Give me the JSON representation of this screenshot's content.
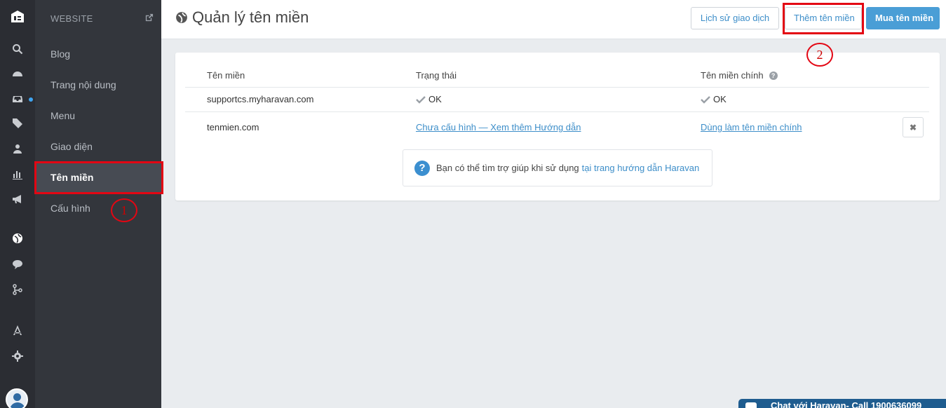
{
  "rail": {
    "icons": [
      "logo-icon",
      "search-icon",
      "dashboard-icon",
      "inbox-icon",
      "tag-icon",
      "users-icon",
      "bar-chart-icon",
      "megaphone-icon",
      "globe-icon",
      "chat-icon",
      "network-icon",
      "app-store-icon",
      "gear-icon",
      "avatar-icon"
    ]
  },
  "sidebar": {
    "header": "WEBSITE",
    "items": [
      {
        "label": "Blog"
      },
      {
        "label": "Trang nội dung"
      },
      {
        "label": "Menu"
      },
      {
        "label": "Giao diện"
      },
      {
        "label": "Tên miền"
      },
      {
        "label": "Cấu hình"
      }
    ],
    "active_index": 4
  },
  "header": {
    "title": "Quản lý tên miền",
    "buttons": {
      "history": "Lịch sử giao dịch",
      "add": "Thêm tên miền",
      "buy": "Mua tên miền"
    }
  },
  "table": {
    "headers": [
      "Tên miền",
      "Trạng thái",
      "Tên miền chính"
    ],
    "rows": [
      {
        "domain": "supportcs.myharavan.com",
        "status": "OK",
        "primary": "OK"
      },
      {
        "domain": "tenmien.com",
        "status": "Chưa cấu hình — Xem thêm Hướng dẫn",
        "primary": "Dùng làm tên miền chính"
      }
    ]
  },
  "help": {
    "text": "Bạn có thể tìm trợ giúp khi sử dụng",
    "link": "tại trang hướng dẫn Haravan"
  },
  "annotations": {
    "one": "1",
    "two": "2"
  },
  "chat": {
    "label": "Chat với Haravan- Call 1900636099"
  },
  "colors": {
    "accent": "#4a9ed6",
    "highlight": "#e30613",
    "sidebar": "#33363c",
    "rail": "#2b2d33"
  }
}
